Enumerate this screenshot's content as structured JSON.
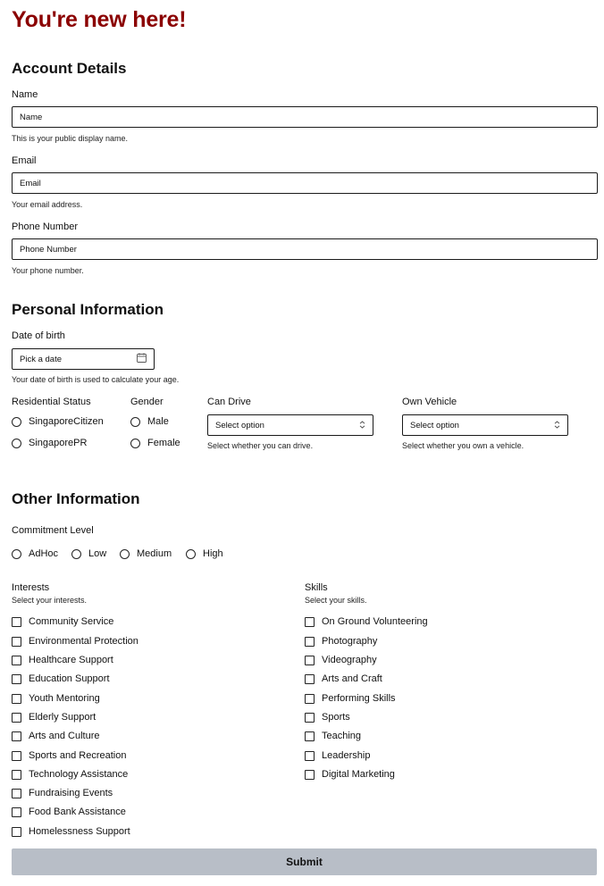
{
  "page_title": "You're new here!",
  "account": {
    "heading": "Account Details",
    "name": {
      "label": "Name",
      "placeholder": "Name",
      "description": "This is your public display name."
    },
    "email": {
      "label": "Email",
      "placeholder": "Email",
      "description": "Your email address."
    },
    "phone": {
      "label": "Phone Number",
      "placeholder": "Phone Number",
      "description": "Your phone number."
    }
  },
  "personal": {
    "heading": "Personal Information",
    "dob": {
      "label": "Date of birth",
      "button_text": "Pick a date",
      "description": "Your date of birth is used to calculate your age."
    },
    "residential": {
      "label": "Residential Status",
      "options": [
        "SingaporeCitizen",
        "SingaporePR"
      ]
    },
    "gender": {
      "label": "Gender",
      "options": [
        "Male",
        "Female"
      ]
    },
    "can_drive": {
      "label": "Can Drive",
      "value": "Select option",
      "description": "Select whether you can drive."
    },
    "own_vehicle": {
      "label": "Own Vehicle",
      "value": "Select option",
      "description": "Select whether you own a vehicle."
    }
  },
  "other": {
    "heading": "Other Information",
    "commitment": {
      "label": "Commitment Level",
      "options": [
        "AdHoc",
        "Low",
        "Medium",
        "High"
      ]
    },
    "interests": {
      "label": "Interests",
      "description": "Select your interests.",
      "items": [
        "Community Service",
        "Environmental Protection",
        "Healthcare Support",
        "Education Support",
        "Youth Mentoring",
        "Elderly Support",
        "Arts and Culture",
        "Sports and Recreation",
        "Technology Assistance",
        "Fundraising Events",
        "Food Bank Assistance",
        "Homelessness Support"
      ]
    },
    "skills": {
      "label": "Skills",
      "description": "Select your skills.",
      "items": [
        "On Ground Volunteering",
        "Photography",
        "Videography",
        "Arts and Craft",
        "Performing Skills",
        "Sports",
        "Teaching",
        "Leadership",
        "Digital Marketing"
      ]
    }
  },
  "submit_label": "Submit",
  "icons": {
    "date": "calendar-icon",
    "select": "chevron-up-down-icon"
  },
  "colors": {
    "title": "#8b0000",
    "submit_bg": "#b8bec7"
  }
}
